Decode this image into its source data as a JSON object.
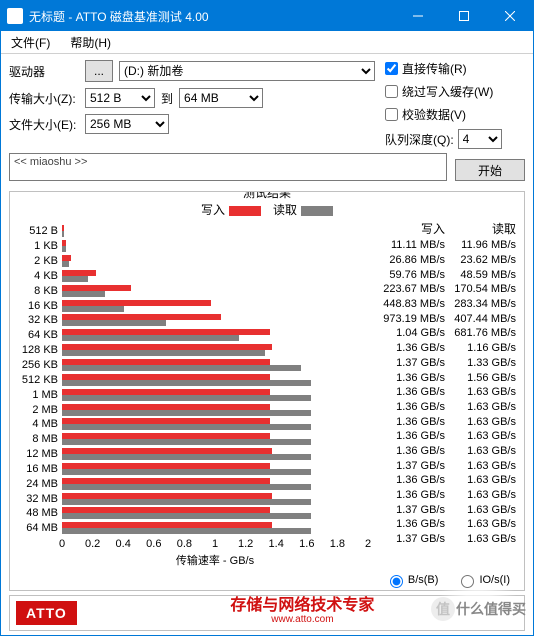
{
  "window": {
    "title": "无标题 - ATTO 磁盘基准测试 4.00"
  },
  "menu": {
    "file": "文件(F)",
    "help": "帮助(H)"
  },
  "labels": {
    "drive": "驱动器",
    "browse": "...",
    "transferSize": "传输大小(Z):",
    "to": "到",
    "fileSize": "文件大小(E):",
    "direct": "直接传输(R)",
    "bypass": "绕过写入缓存(W)",
    "verify": "校验数据(V)",
    "queueDepth": "队列深度(Q):",
    "start": "开始",
    "results": "测试结果",
    "write": "写入",
    "read": "读取",
    "xlabel": "传输速率 - GB/s",
    "unitB": "B/s(B)",
    "unitIO": "IO/s(I)"
  },
  "selects": {
    "drive": "(D:) 新加卷",
    "tsFrom": "512 B",
    "tsTo": "64 MB",
    "fileSize": "256 MB",
    "queueDepth": "4"
  },
  "checks": {
    "direct": true,
    "bypass": false,
    "verify": false
  },
  "desc": "<< miaoshu >>",
  "unitSelected": "B",
  "footer": {
    "logo": "ATTO",
    "slogan": "存储与网络技术专家",
    "url": "www.atto.com"
  },
  "watermark": "什么值得买",
  "chart_data": {
    "type": "bar",
    "title": "测试结果",
    "xlabel": "传输速率 - GB/s",
    "ylabel": "",
    "xlim": [
      0,
      2
    ],
    "xticks": [
      0,
      0.2,
      0.4,
      0.6,
      0.8,
      1.0,
      1.2,
      1.4,
      1.6,
      1.8,
      2
    ],
    "categories": [
      "512 B",
      "1 KB",
      "2 KB",
      "4 KB",
      "8 KB",
      "16 KB",
      "32 KB",
      "64 KB",
      "128 KB",
      "256 KB",
      "512 KB",
      "1 MB",
      "2 MB",
      "4 MB",
      "8 MB",
      "12 MB",
      "16 MB",
      "24 MB",
      "32 MB",
      "48 MB",
      "64 MB"
    ],
    "series": [
      {
        "name": "写入",
        "display": [
          "11.11 MB/s",
          "26.86 MB/s",
          "59.76 MB/s",
          "223.67 MB/s",
          "448.83 MB/s",
          "973.19 MB/s",
          "1.04 GB/s",
          "1.36 GB/s",
          "1.37 GB/s",
          "1.36 GB/s",
          "1.36 GB/s",
          "1.36 GB/s",
          "1.36 GB/s",
          "1.36 GB/s",
          "1.36 GB/s",
          "1.37 GB/s",
          "1.36 GB/s",
          "1.36 GB/s",
          "1.37 GB/s",
          "1.36 GB/s",
          "1.37 GB/s"
        ],
        "values_gb": [
          0.01111,
          0.02686,
          0.05976,
          0.22367,
          0.44883,
          0.97319,
          1.04,
          1.36,
          1.37,
          1.36,
          1.36,
          1.36,
          1.36,
          1.36,
          1.36,
          1.37,
          1.36,
          1.36,
          1.37,
          1.36,
          1.37
        ]
      },
      {
        "name": "读取",
        "display": [
          "11.96 MB/s",
          "23.62 MB/s",
          "48.59 MB/s",
          "170.54 MB/s",
          "283.34 MB/s",
          "407.44 MB/s",
          "681.76 MB/s",
          "1.16 GB/s",
          "1.33 GB/s",
          "1.56 GB/s",
          "1.63 GB/s",
          "1.63 GB/s",
          "1.63 GB/s",
          "1.63 GB/s",
          "1.63 GB/s",
          "1.63 GB/s",
          "1.63 GB/s",
          "1.63 GB/s",
          "1.63 GB/s",
          "1.63 GB/s",
          "1.63 GB/s"
        ],
        "values_gb": [
          0.01196,
          0.02362,
          0.04859,
          0.17054,
          0.28334,
          0.40744,
          0.68176,
          1.16,
          1.33,
          1.56,
          1.63,
          1.63,
          1.63,
          1.63,
          1.63,
          1.63,
          1.63,
          1.63,
          1.63,
          1.63,
          1.63
        ]
      }
    ]
  }
}
